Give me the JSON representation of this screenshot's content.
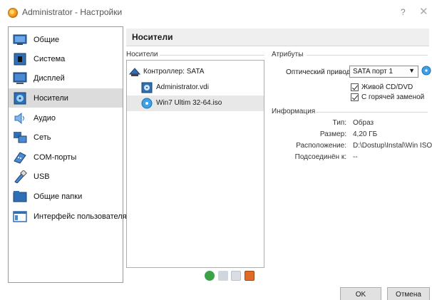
{
  "window": {
    "title": "Administrator - Настройки",
    "help": "?",
    "close": "✕"
  },
  "sidebar": {
    "items": [
      {
        "label": "Общие",
        "icon": "general-icon"
      },
      {
        "label": "Система",
        "icon": "system-icon"
      },
      {
        "label": "Дисплей",
        "icon": "display-icon"
      },
      {
        "label": "Носители",
        "icon": "storage-icon",
        "active": true
      },
      {
        "label": "Аудио",
        "icon": "audio-icon"
      },
      {
        "label": "Сеть",
        "icon": "network-icon"
      },
      {
        "label": "COM-порты",
        "icon": "serial-ports-icon"
      },
      {
        "label": "USB",
        "icon": "usb-icon"
      },
      {
        "label": "Общие папки",
        "icon": "shared-folders-icon"
      },
      {
        "label": "Интерфейс пользователя",
        "icon": "user-interface-icon"
      }
    ]
  },
  "main": {
    "title": "Носители"
  },
  "storage_tree": {
    "group_label": "Носители",
    "controller": "Контроллер: SATA",
    "items": [
      {
        "label": "Administrator.vdi",
        "icon": "hard-disk-icon"
      },
      {
        "label": "Win7 Ultim 32-64.iso",
        "icon": "optical-disc-icon",
        "selected": true
      }
    ]
  },
  "attributes": {
    "group_label": "Атрибуты",
    "optical_drive_label": "Оптический привод:",
    "optical_drive_value": "SATA порт 1",
    "live_cd_label": "Живой CD/DVD",
    "live_cd_checked": true,
    "hot_plug_label": "С горячей заменой",
    "hot_plug_checked": true
  },
  "information": {
    "group_label": "Информация",
    "rows": [
      {
        "key": "Тип:",
        "value": "Образ"
      },
      {
        "key": "Размер:",
        "value": "4,20 ГБ"
      },
      {
        "key": "Расположение:",
        "value": "D:\\Dostup\\Instal\\Win ISO..."
      },
      {
        "key": "Подсоединён к:",
        "value": "--"
      }
    ]
  },
  "footer": {
    "ok": "OK",
    "cancel": "Отмена"
  },
  "colors": {
    "active_item_bg": "#dcdcdc",
    "accent_blue": "#1e73be"
  }
}
